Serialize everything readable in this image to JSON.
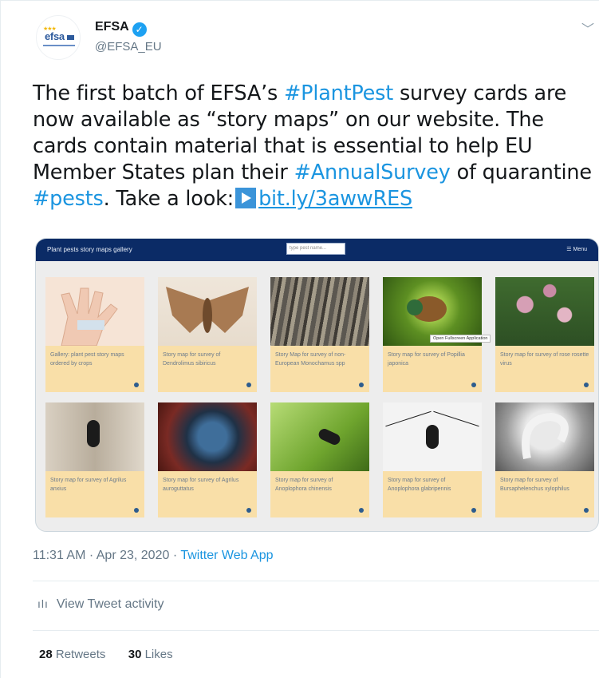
{
  "author": {
    "name": "EFSA",
    "handle": "@EFSA_EU",
    "verified": true,
    "avatar_text": "efsa"
  },
  "tweet": {
    "segments": [
      {
        "text": "The first batch of EFSA’s ",
        "type": "text"
      },
      {
        "text": "#PlantPest",
        "type": "hashtag"
      },
      {
        "text": " survey cards are now available as “story maps” on our website. The cards contain material that is essential to help EU Member States plan their ",
        "type": "text"
      },
      {
        "text": "#AnnualSurvey",
        "type": "hashtag"
      },
      {
        "text": " of quarantine ",
        "type": "text"
      },
      {
        "text": "#pests",
        "type": "hashtag"
      },
      {
        "text": ". Take a look:",
        "type": "text"
      },
      {
        "text": "bit.ly/3awwRES",
        "type": "link"
      }
    ]
  },
  "media": {
    "app_title": "Plant pests story maps gallery",
    "search_placeholder": "type pest name...",
    "menu_label": "☰ Menu",
    "tooltip": "Open Fullscreen Application",
    "cards": [
      {
        "caption": "Gallery: plant pest story maps ordered by crops",
        "image": "hand"
      },
      {
        "caption": "Story map for survey of Dendrolimus sibiricus",
        "image": "moth"
      },
      {
        "caption": "Story Map for survey of non-European Monochamus spp",
        "image": "bark"
      },
      {
        "caption": "Story map for survey of Popillia japonica",
        "image": "beetle"
      },
      {
        "caption": "Story map for survey of rose rosette virus",
        "image": "rose"
      },
      {
        "caption": "Story map for survey of Agrilus anxius",
        "image": "borer"
      },
      {
        "caption": "Story map for survey of Agrilus auroguttatus",
        "image": "jewel"
      },
      {
        "caption": "Story map for survey of Anoplophora chinensis",
        "image": "leaf"
      },
      {
        "caption": "Story map for survey of Anoplophora glabripennis",
        "image": "bug"
      },
      {
        "caption": "Story map for survey of Bursaphelenchus xylophilus",
        "image": "sem"
      }
    ]
  },
  "footer": {
    "time": "11:31 AM · Apr 23, 2020 · ",
    "app": "Twitter Web App",
    "activity_label": "View Tweet activity",
    "retweets_count": "28",
    "retweets_label": "Retweets",
    "likes_count": "30",
    "likes_label": "Likes"
  },
  "colors": {
    "link": "#1b95e0",
    "verified": "#1da1f2",
    "app_bar": "#0b2b66",
    "card": "#f9dfa8"
  }
}
